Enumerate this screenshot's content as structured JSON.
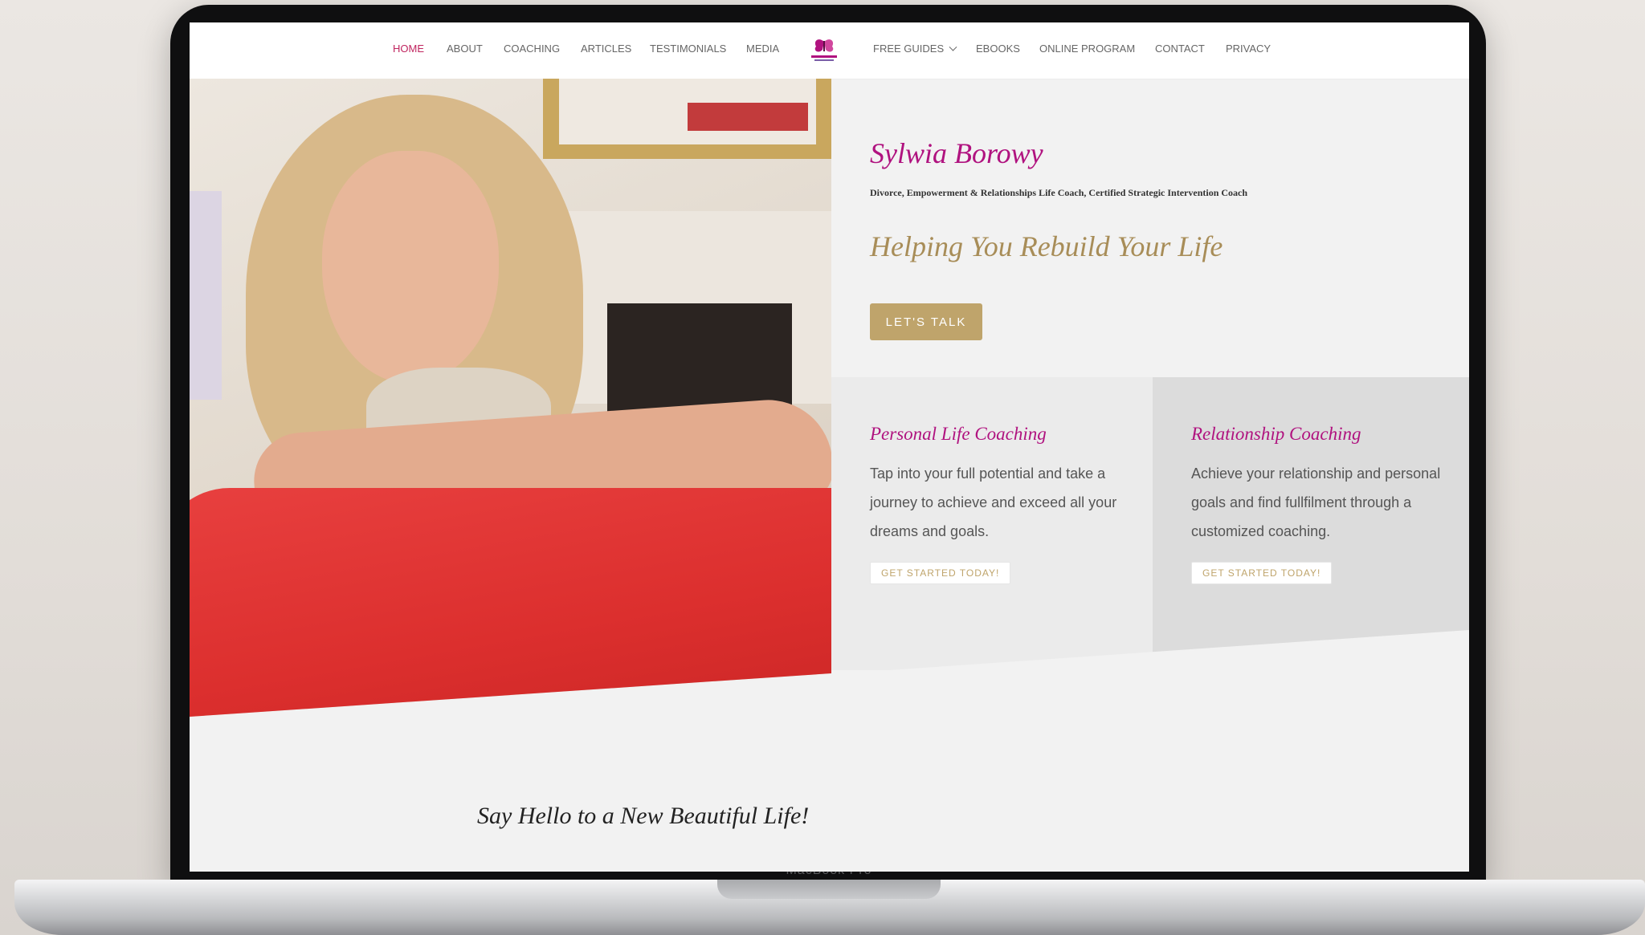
{
  "nav": {
    "items": [
      {
        "label": "HOME",
        "active": true
      },
      {
        "label": "ABOUT"
      },
      {
        "label": "COACHING"
      },
      {
        "label": "ARTICLES"
      },
      {
        "label": "TESTIMONIALS"
      },
      {
        "label": "MEDIA"
      },
      {
        "label": "FREE GUIDES"
      },
      {
        "label": "EBOOKS"
      },
      {
        "label": "ONLINE PROGRAM"
      },
      {
        "label": "CONTACT"
      },
      {
        "label": "PRIVACY"
      }
    ],
    "logo_icon": "butterfly-logo-icon"
  },
  "intro": {
    "name": "Sylwia Borowy",
    "subtitle": "Divorce, Empowerment & Relationships Life Coach, Certified Strategic Intervention Coach",
    "tagline": "Helping You Rebuild Your Life",
    "cta_label": "LET'S TALK"
  },
  "services": [
    {
      "title": "Personal Life Coaching",
      "text": "Tap into your full potential and take a journey to achieve and exceed all your dreams and goals.",
      "button": "GET STARTED TODAY!"
    },
    {
      "title": "Relationship Coaching",
      "text": "Achieve your relationship and personal goals and find fullfilment through a customized coaching.",
      "button": "GET STARTED TODAY!"
    }
  ],
  "section": {
    "heading": "Say Hello to a New Beautiful Life!"
  },
  "device": {
    "brand": "MacBook Pro"
  },
  "colors": {
    "accent_magenta": "#b0127f",
    "accent_gold": "#bfa46b",
    "nav_active": "#c0255f"
  }
}
